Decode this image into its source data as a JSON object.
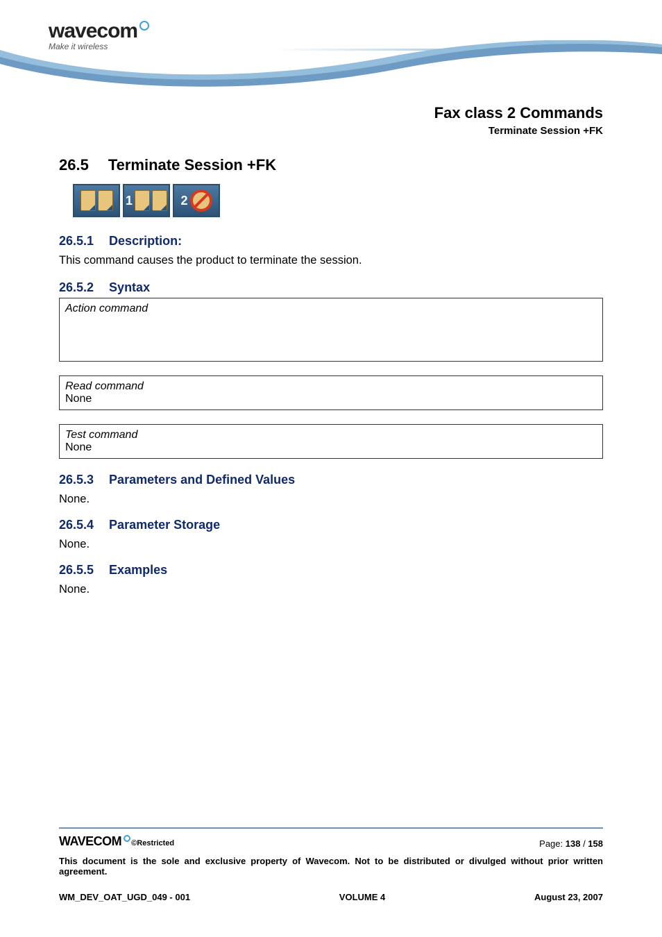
{
  "logo": {
    "brand": "wavecom",
    "tagline": "Make it wireless"
  },
  "chapter": {
    "title": "Fax class 2 Commands",
    "subtitle": "Terminate Session +FK"
  },
  "section": {
    "num": "26.5",
    "title": "Terminate Session +FK"
  },
  "icons": {
    "badge1": "1",
    "badge2": "2"
  },
  "sub1": {
    "num": "26.5.1",
    "title": "Description:",
    "text": "This command causes the product to terminate the session."
  },
  "sub2": {
    "num": "26.5.2",
    "title": "Syntax",
    "boxes": {
      "action": {
        "label": "Action command"
      },
      "read": {
        "label": "Read command",
        "value": "None"
      },
      "test": {
        "label": "Test command",
        "value": "None"
      }
    }
  },
  "sub3": {
    "num": "26.5.3",
    "title": "Parameters and Defined Values",
    "text": "None."
  },
  "sub4": {
    "num": "26.5.4",
    "title": "Parameter Storage",
    "text": "None."
  },
  "sub5": {
    "num": "26.5.5",
    "title": "Examples",
    "text": "None."
  },
  "footer": {
    "brand": "WAVECOM",
    "restricted": "©Restricted",
    "page_label": "Page: ",
    "page_cur": "138",
    "page_sep": " / ",
    "page_total": "158",
    "notice": "This document is the sole and exclusive property of Wavecom. Not to be distributed or divulged without prior written agreement.",
    "docref": "WM_DEV_OAT_UGD_049 - 001",
    "volume": "VOLUME 4",
    "date": "August 23, 2007"
  }
}
